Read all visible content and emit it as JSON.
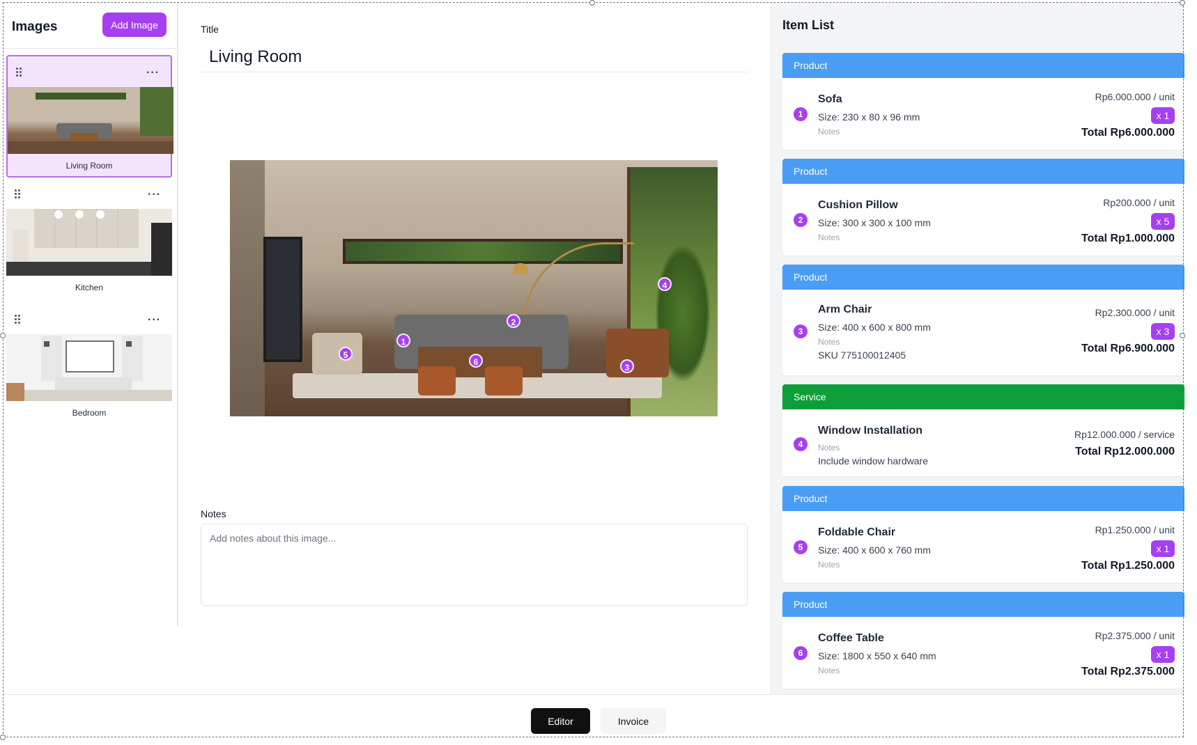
{
  "sidebar": {
    "title": "Images",
    "add_button_label": "Add Image",
    "images": [
      {
        "label": "Living Room",
        "selected": true
      },
      {
        "label": "Kitchen",
        "selected": false
      },
      {
        "label": "Bedroom",
        "selected": false
      }
    ]
  },
  "editor": {
    "title_label": "Title",
    "title_value": "Living Room",
    "markers": [
      "1",
      "2",
      "3",
      "4",
      "5",
      "6"
    ],
    "notes_label": "Notes",
    "notes_placeholder": "Add notes about this image..."
  },
  "item_list": {
    "title": "Item List",
    "items": [
      {
        "num": "1",
        "type": "Product",
        "name": "Sofa",
        "size": "Size: 230 x 80 x 96 mm",
        "notes_label": "Notes",
        "note_text": "",
        "price": "Rp6.000.000 / unit",
        "qty": "x 1",
        "total": "Total Rp6.000.000"
      },
      {
        "num": "2",
        "type": "Product",
        "name": "Cushion Pillow",
        "size": "Size: 300 x 300 x 100 mm",
        "notes_label": "Notes",
        "note_text": "",
        "price": "Rp200.000 / unit",
        "qty": "x 5",
        "total": "Total Rp1.000.000"
      },
      {
        "num": "3",
        "type": "Product",
        "name": "Arm Chair",
        "size": "Size: 400 x 600 x 800 mm",
        "notes_label": "Notes",
        "note_text": "SKU 775100012405",
        "price": "Rp2.300.000 / unit",
        "qty": "x 3",
        "total": "Total Rp6.900.000"
      },
      {
        "num": "4",
        "type": "Service",
        "name": "Window Installation",
        "size": "",
        "notes_label": "Notes",
        "note_text": "Include window hardware",
        "price": "Rp12.000.000 / service",
        "qty": "",
        "total": "Total Rp12.000.000"
      },
      {
        "num": "5",
        "type": "Product",
        "name": "Foldable Chair",
        "size": "Size: 400 x 600 x 760 mm",
        "notes_label": "Notes",
        "note_text": "",
        "price": "Rp1.250.000 / unit",
        "qty": "x 1",
        "total": "Total Rp1.250.000"
      },
      {
        "num": "6",
        "type": "Product",
        "name": "Coffee Table",
        "size": "Size: 1800 x 550 x 640 mm",
        "notes_label": "Notes",
        "note_text": "",
        "price": "Rp2.375.000 / unit",
        "qty": "x 1",
        "total": "Total Rp2.375.000"
      }
    ]
  },
  "bottom_tabs": {
    "editor_label": "Editor",
    "invoice_label": "Invoice",
    "active": "Editor"
  },
  "colors": {
    "accent": "#a63ff0",
    "product_header": "#4a9df4",
    "service_header": "#0d9e3a"
  }
}
